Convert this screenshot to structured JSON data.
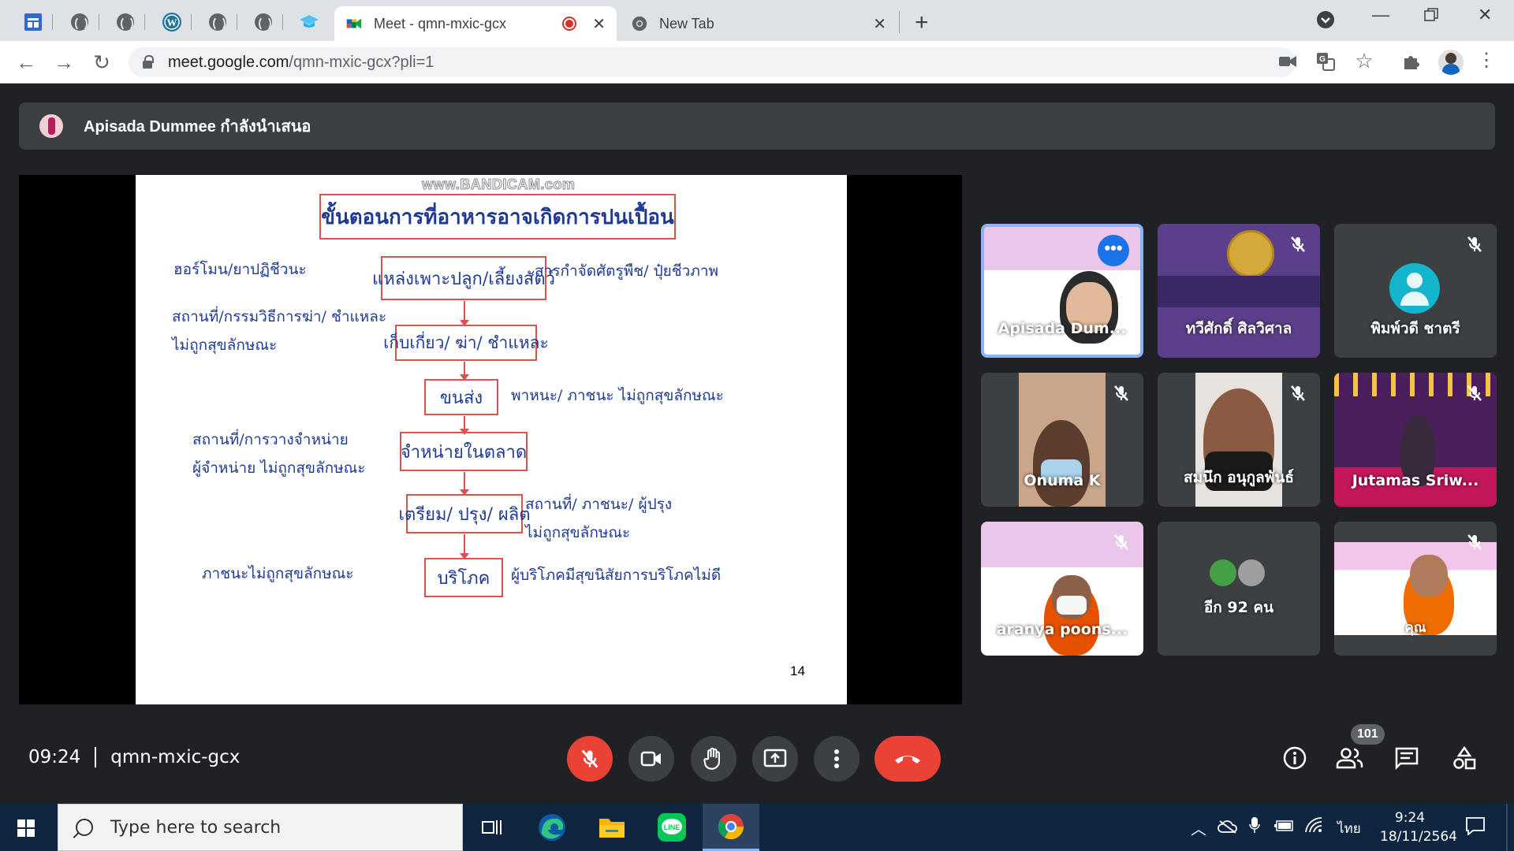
{
  "browser": {
    "tabs": [
      {
        "title": "Meet - qmn-mxic-gcx",
        "active": true,
        "recording": true
      },
      {
        "title": "New Tab",
        "active": false
      }
    ],
    "pinned_icons": [
      "calendar-app-icon",
      "globe-icon",
      "globe-icon",
      "wordpress-icon",
      "globe-icon",
      "globe-icon",
      "graduation-cap-icon"
    ],
    "url_host": "meet.google.com",
    "url_path": "/qmn-mxic-gcx?pli=1"
  },
  "meet": {
    "presenting_text": "Apisada Dummee กำลังนำเสนอ",
    "slide": {
      "watermark": "www.BANDICAM.com",
      "title": "ขั้นตอนการที่อาหารอาจเกิดการปนเปื้อน",
      "steps": [
        "แหล่งเพาะปลูก/เลี้ยงสัตว์",
        "เก็บเกี่ยว/ ฆ่า/ ชำแหละ",
        "ขนส่ง",
        "จำหน่ายในตลาด",
        "เตรียม/ ปรุง/ ผลิต",
        "บริโภค"
      ],
      "left_notes": [
        [
          "ฮอร์โมน/ยาปฏิชีวนะ"
        ],
        [
          "สถานที่/กรรมวิธีการฆ่า/ ชำแหละ",
          "ไม่ถูกสุขลักษณะ"
        ],
        [
          "สถานที่/การวางจำหน่าย",
          "ผู้จำหน่าย ไม่ถูกสุขลักษณะ"
        ],
        [
          "ภาชนะไม่ถูกสุขลักษณะ"
        ]
      ],
      "right_notes": [
        [
          "สารกำจัดศัตรูพืช/ ปุ๋ยชีวภาพ"
        ],
        [
          "พาหนะ/ ภาชนะ ไม่ถูกสุขลักษณะ"
        ],
        [
          "สถานที่/ ภาชนะ/ ผู้ปรุง",
          "ไม่ถูกสุขลักษณะ"
        ],
        [
          "ผู้บริโภคมีสุขนิสัยการบริโภคไม่ดี"
        ]
      ],
      "page_number": "14"
    },
    "participants": [
      {
        "name": "Apisada Dum...",
        "speaking": true
      },
      {
        "name": "ทวีศักดิ์ ศิลวิศาล",
        "muted": true
      },
      {
        "name": "พิมพ์วดี ชาตรี",
        "muted": true
      },
      {
        "name": "Onuma K",
        "muted": true
      },
      {
        "name": "สมนึก อนุกูลพันธ์",
        "muted": true
      },
      {
        "name": "Jutamas Sriw...",
        "muted": true
      },
      {
        "name": "aranya poons...",
        "muted": true
      },
      {
        "name": "อีก 92 คน"
      },
      {
        "name": "คุณ",
        "muted": true
      }
    ],
    "time": "09:24",
    "meeting_code": "qmn-mxic-gcx",
    "people_count": "101",
    "colors": {
      "accent_red": "#ea4335",
      "speaking_border": "#8ab4f8",
      "tile_bg": "#3c4043"
    }
  },
  "taskbar": {
    "search_placeholder": "Type here to search",
    "language": "ไทย",
    "time": "9:24",
    "date": "18/11/2564"
  }
}
